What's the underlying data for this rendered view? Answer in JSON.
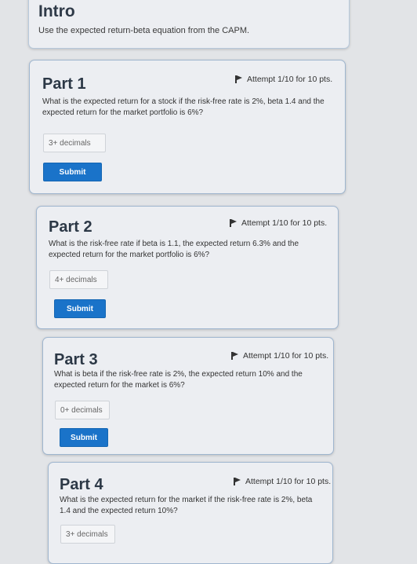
{
  "intro": {
    "title": "Intro",
    "text": "Use the expected return-beta equation from the CAPM."
  },
  "parts": [
    {
      "title": "Part 1",
      "attempt": "Attempt 1/10 for 10 pts.",
      "question": "What is the expected return for a stock if the risk-free rate is 2%, beta 1.4 and the expected return for the market portfolio is 6%?",
      "input_placeholder": "3+ decimals",
      "submit_label": "Submit"
    },
    {
      "title": "Part 2",
      "attempt": "Attempt 1/10 for 10 pts.",
      "question": "What is the risk-free rate if beta is 1.1, the expected return 6.3% and the expected return for the market portfolio is 6%?",
      "input_placeholder": "4+ decimals",
      "submit_label": "Submit"
    },
    {
      "title": "Part 3",
      "attempt": "Attempt 1/10 for 10 pts.",
      "question": "What is beta if the risk-free rate is 2%, the expected return 10% and the expected return for the market is 6%?",
      "input_placeholder": "0+ decimals",
      "submit_label": "Submit"
    },
    {
      "title": "Part 4",
      "attempt": "Attempt 1/10 for 10 pts.",
      "question": "What is the expected return for the market if the risk-free rate is 2%, beta 1.4 and the expected return 10%?",
      "input_placeholder": "3+ decimals"
    }
  ],
  "icons": {
    "attempt": "flag-icon"
  },
  "colors": {
    "submit_button": "#1a73c9",
    "card_border": "#9fb6cf",
    "page_background": "#e2e4e7"
  }
}
